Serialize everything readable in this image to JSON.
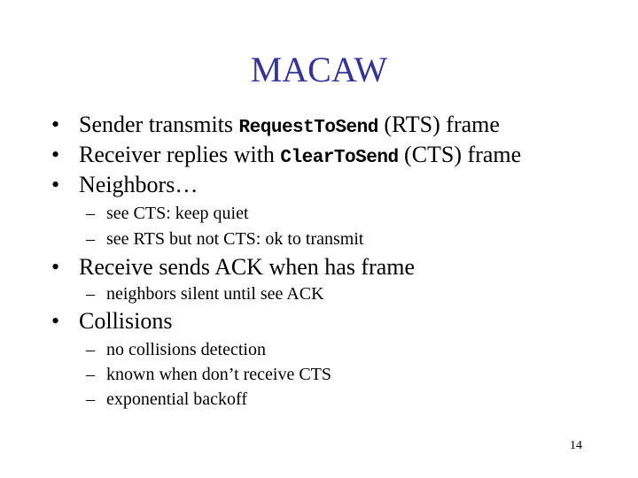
{
  "slide": {
    "title": "MACAW",
    "page_number": "14",
    "title_color": "#333399",
    "bullet_glyph": "•",
    "dash_glyph": "–",
    "items": [
      {
        "pre": "Sender transmits ",
        "code": "RequestToSend",
        "post": " (RTS) frame"
      },
      {
        "pre": "Receiver replies with ",
        "code": "ClearToSend",
        "post": " (CTS) frame"
      },
      {
        "text": "Neighbors…"
      },
      {
        "sub": "see CTS: keep quiet"
      },
      {
        "sub": "see RTS but not CTS: ok to transmit"
      },
      {
        "text": "Receive sends ACK when has frame"
      },
      {
        "sub": "neighbors silent until see ACK"
      },
      {
        "text": "Collisions"
      },
      {
        "sub": "no collisions detection"
      },
      {
        "sub": "known when don’t receive CTS"
      },
      {
        "sub": "exponential backoff"
      }
    ]
  }
}
